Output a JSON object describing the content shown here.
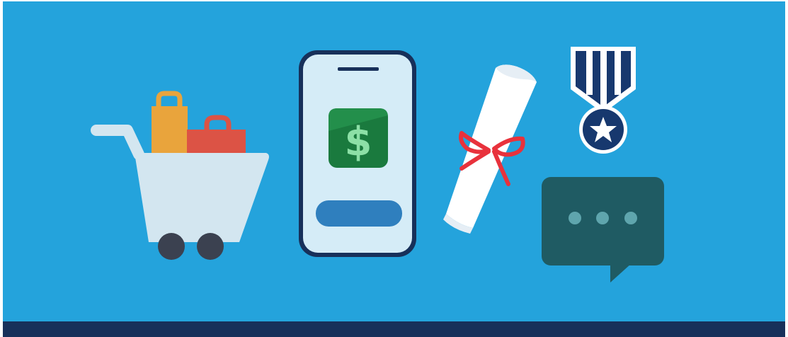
{
  "illustration": {
    "colors": {
      "background": "#24a3dc",
      "footer_bar": "#17305a",
      "cart_body": "#d3e6f0",
      "cart_wheel": "#3b4150",
      "bag_orange": "#e9a43c",
      "bag_red": "#dc5345",
      "phone_frame": "#17305a",
      "phone_screen": "#d5ecf7",
      "app_icon_green": "#1a7a3e",
      "dollar_sign": "#8ce0a6",
      "phone_button": "#2f7fbe",
      "diploma": "#ffffff",
      "ribbon": "#e8323c",
      "medal_navy": "#17386e",
      "medal_white": "#ffffff",
      "chat_bubble": "#1f5b63",
      "chat_dots": "#5fa5ad"
    },
    "phone_app_glyph": "$",
    "icons": [
      "shopping-cart-icon",
      "shopping-bag-icon",
      "smartphone-icon",
      "dollar-icon",
      "diploma-scroll-icon",
      "medal-icon",
      "star-icon",
      "chat-bubble-icon"
    ]
  }
}
